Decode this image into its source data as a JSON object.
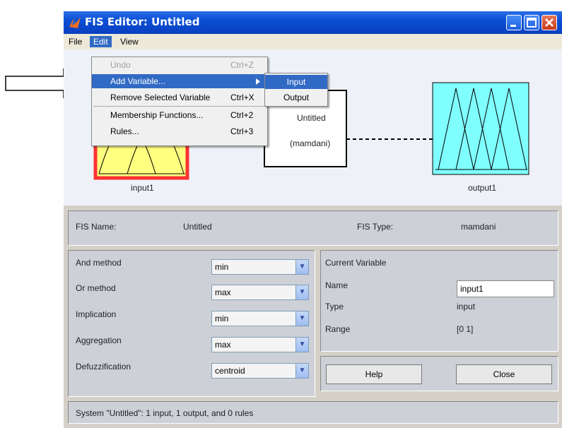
{
  "window": {
    "title": "FIS Editor: Untitled"
  },
  "menubar": {
    "items": [
      "File",
      "Edit",
      "View"
    ]
  },
  "edit_menu": {
    "items": [
      {
        "label": "Undo",
        "shortcut": "Ctrl+Z",
        "disabled": true
      },
      {
        "label": "Add Variable...",
        "shortcut": "",
        "highlighted": true,
        "submenu": true
      },
      {
        "label": "Remove Selected Variable",
        "shortcut": "Ctrl+X"
      },
      {
        "label": "Membership Functions...",
        "shortcut": "Ctrl+2"
      },
      {
        "label": "Rules...",
        "shortcut": "Ctrl+3"
      }
    ]
  },
  "add_variable_submenu": {
    "items": [
      "Input",
      "Output"
    ],
    "highlighted": "Input"
  },
  "diagram": {
    "input_label": "input1",
    "system_name": "Untitled",
    "system_type": "(mamdani)",
    "output_label": "output1"
  },
  "fis_info": {
    "name_label": "FIS Name:",
    "name_value": "Untitled",
    "type_label": "FIS Type:",
    "type_value": "mamdani"
  },
  "methods": [
    {
      "label": "And method",
      "value": "min"
    },
    {
      "label": "Or method",
      "value": "max"
    },
    {
      "label": "Implication",
      "value": "min"
    },
    {
      "label": "Aggregation",
      "value": "max"
    },
    {
      "label": "Defuzzification",
      "value": "centroid"
    }
  ],
  "current_variable": {
    "heading": "Current Variable",
    "name_label": "Name",
    "name_value": "input1",
    "type_label": "Type",
    "type_value": "input",
    "range_label": "Range",
    "range_value": "[0 1]"
  },
  "buttons": {
    "help": "Help",
    "close": "Close"
  },
  "status": "System \"Untitled\": 1 input, 1 output, and 0 rules",
  "colors": {
    "title_bar": "#0a4fd4",
    "menu_highlight": "#316ac5",
    "input_fill": "#ffff80",
    "input_border": "#ff3333",
    "output_fill": "#80ffff"
  },
  "icons": [
    "matlab-icon",
    "minimize-icon",
    "maximize-icon",
    "close-icon",
    "arrow-pointer-icon"
  ]
}
